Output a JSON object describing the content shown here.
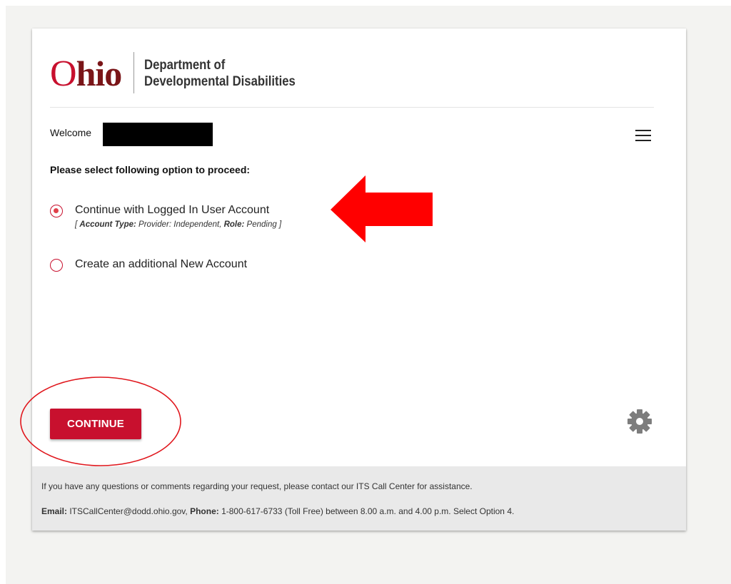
{
  "logo": {
    "word_first": "O",
    "word_rest": "hio",
    "dept_line1": "Department of",
    "dept_line2": "Developmental Disabilities"
  },
  "welcome": {
    "label": "Welcome"
  },
  "prompt": "Please select following option to proceed:",
  "options": [
    {
      "label": "Continue with Logged In User Account",
      "checked": true,
      "meta": {
        "open": "[ ",
        "account_type_label": "Account Type:",
        "account_type_value": " Provider: Independent, ",
        "role_label": "Role:",
        "role_value": " Pending ]"
      }
    },
    {
      "label": "Create an additional New Account",
      "checked": false
    }
  ],
  "actions": {
    "continue_label": "CONTINUE"
  },
  "footer": {
    "line1": "If you have any questions or comments regarding your request, please contact our ITS Call Center for assistance.",
    "email_label": "Email:",
    "email_value": " ITSCallCenter@dodd.ohio.gov,  ",
    "phone_label": "Phone:",
    "phone_value": " 1-800-617-6733 (Toll Free) between 8.00 a.m. and 4.00 p.m. Select Option 4."
  },
  "icons": {
    "menu": "hamburger-menu-icon",
    "settings": "gear-icon"
  },
  "colors": {
    "brand_red": "#c8102e",
    "logo_dark_red": "#7a1518",
    "annotation_red": "#ff0000",
    "footer_bg": "#e9e9e9"
  }
}
